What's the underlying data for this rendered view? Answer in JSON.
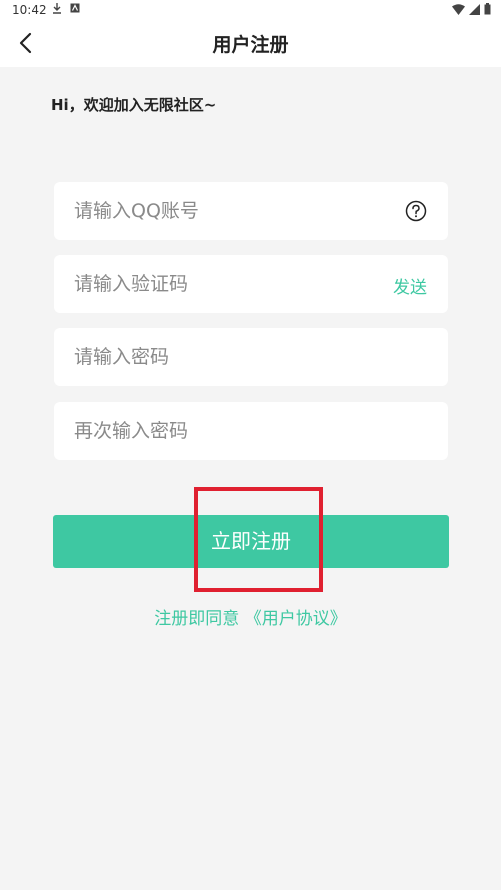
{
  "status_bar": {
    "time": "10:42",
    "icons": [
      "download-icon",
      "notification-icon",
      "wifi-icon",
      "signal-icon",
      "battery-icon"
    ]
  },
  "header": {
    "title": "用户注册"
  },
  "greeting": "Hi，欢迎加入无限社区~",
  "form": {
    "qq_placeholder": "请输入QQ账号",
    "code_placeholder": "请输入验证码",
    "send_label": "发送",
    "password_placeholder": "请输入密码",
    "confirm_password_placeholder": "再次输入密码"
  },
  "register_label": "立即注册",
  "agreement": {
    "prefix": "注册即同意 ",
    "link": "《用户协议》"
  },
  "colors": {
    "accent": "#3ec8a2",
    "highlight": "#e02030",
    "background": "#f4f4f4"
  }
}
